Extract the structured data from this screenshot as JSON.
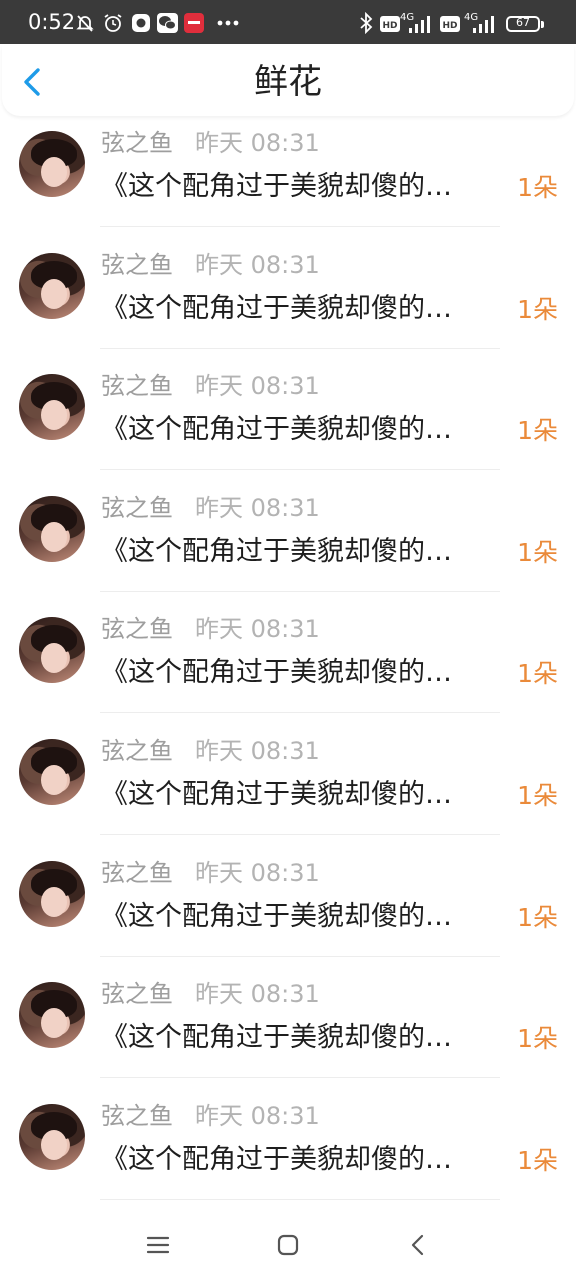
{
  "status_bar": {
    "time": "0:52",
    "battery": "67",
    "network_1": "4G",
    "network_2": "4G"
  },
  "header": {
    "title": "鲜花"
  },
  "list": {
    "items": [
      {
        "user": "弦之鱼",
        "time": "昨天 08:31",
        "title": "《这个配角过于美貌却傻的…",
        "count": "1朵"
      },
      {
        "user": "弦之鱼",
        "time": "昨天 08:31",
        "title": "《这个配角过于美貌却傻的…",
        "count": "1朵"
      },
      {
        "user": "弦之鱼",
        "time": "昨天 08:31",
        "title": "《这个配角过于美貌却傻的…",
        "count": "1朵"
      },
      {
        "user": "弦之鱼",
        "time": "昨天 08:31",
        "title": "《这个配角过于美貌却傻的…",
        "count": "1朵"
      },
      {
        "user": "弦之鱼",
        "time": "昨天 08:31",
        "title": "《这个配角过于美貌却傻的…",
        "count": "1朵"
      },
      {
        "user": "弦之鱼",
        "time": "昨天 08:31",
        "title": "《这个配角过于美貌却傻的…",
        "count": "1朵"
      },
      {
        "user": "弦之鱼",
        "time": "昨天 08:31",
        "title": "《这个配角过于美貌却傻的…",
        "count": "1朵"
      },
      {
        "user": "弦之鱼",
        "time": "昨天 08:31",
        "title": "《这个配角过于美貌却傻的…",
        "count": "1朵"
      },
      {
        "user": "弦之鱼",
        "time": "昨天 08:31",
        "title": "《这个配角过于美貌却傻的…",
        "count": "1朵"
      }
    ]
  },
  "colors": {
    "accent_blue": "#1e9be8",
    "count_orange": "#ea8a3a"
  },
  "icons": [
    "mute-icon",
    "alarm-icon",
    "app-icon",
    "wechat-icon",
    "app-badge-icon",
    "more-icon",
    "bluetooth-icon",
    "hd-icon",
    "signal-icon",
    "battery-icon",
    "back-arrow-icon",
    "menu-icon",
    "home-icon",
    "back-nav-icon"
  ]
}
